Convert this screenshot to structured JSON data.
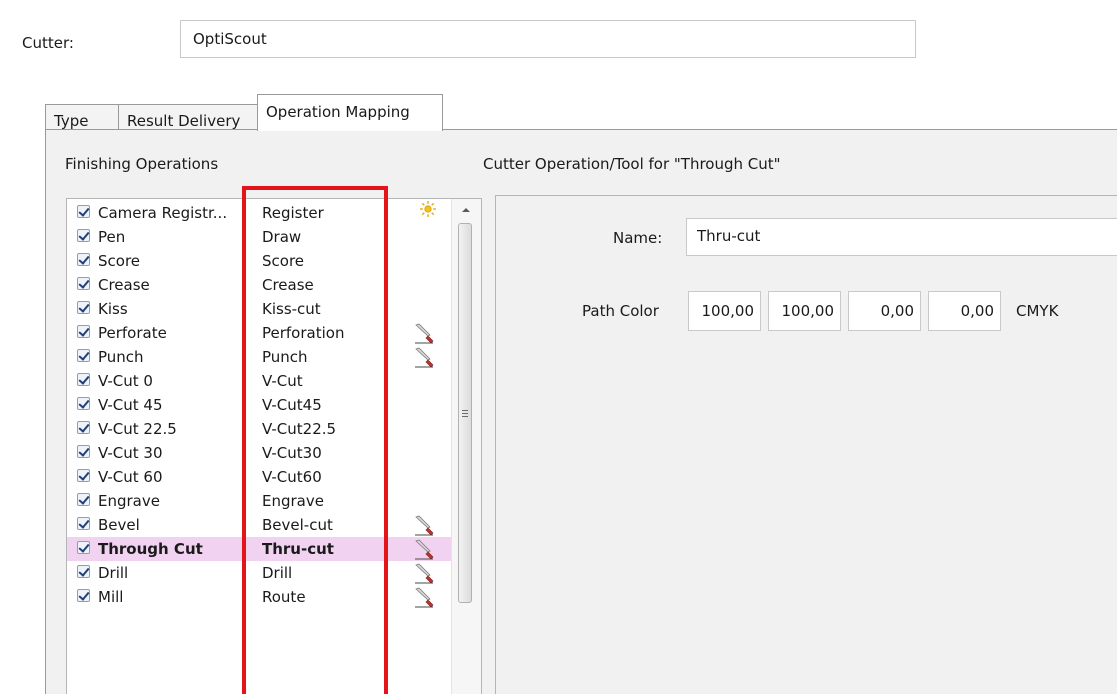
{
  "cutter": {
    "label": "Cutter:",
    "value": "OptiScout"
  },
  "tabs": [
    {
      "label": "Type",
      "active": false
    },
    {
      "label": "Result Delivery",
      "active": false
    },
    {
      "label": "Operation Mapping",
      "active": true
    }
  ],
  "left": {
    "title": "Finishing Operations",
    "rows": [
      {
        "operation": "Camera Registr...",
        "tool": "Register",
        "checked": true,
        "icon": "sun-icon"
      },
      {
        "operation": "Pen",
        "tool": "Draw",
        "checked": true,
        "icon": ""
      },
      {
        "operation": "Score",
        "tool": "Score",
        "checked": true,
        "icon": ""
      },
      {
        "operation": "Crease",
        "tool": "Crease",
        "checked": true,
        "icon": ""
      },
      {
        "operation": "Kiss",
        "tool": "Kiss-cut",
        "checked": true,
        "icon": ""
      },
      {
        "operation": "Perforate",
        "tool": "Perforation",
        "checked": true,
        "icon": "knife-icon"
      },
      {
        "operation": "Punch",
        "tool": "Punch",
        "checked": true,
        "icon": "knife-icon"
      },
      {
        "operation": "V-Cut 0",
        "tool": "V-Cut",
        "checked": true,
        "icon": ""
      },
      {
        "operation": "V-Cut 45",
        "tool": "V-Cut45",
        "checked": true,
        "icon": ""
      },
      {
        "operation": "V-Cut 22.5",
        "tool": "V-Cut22.5",
        "checked": true,
        "icon": ""
      },
      {
        "operation": "V-Cut 30",
        "tool": "V-Cut30",
        "checked": true,
        "icon": ""
      },
      {
        "operation": "V-Cut 60",
        "tool": "V-Cut60",
        "checked": true,
        "icon": ""
      },
      {
        "operation": "Engrave",
        "tool": "Engrave",
        "checked": true,
        "icon": ""
      },
      {
        "operation": "Bevel",
        "tool": "Bevel-cut",
        "checked": true,
        "icon": "knife-icon"
      },
      {
        "operation": "Through Cut",
        "tool": "Thru-cut",
        "checked": true,
        "icon": "knife-icon",
        "selected": true
      },
      {
        "operation": "Drill",
        "tool": "Drill",
        "checked": true,
        "icon": "knife-icon"
      },
      {
        "operation": "Mill",
        "tool": "Route",
        "checked": true,
        "icon": "knife-icon"
      }
    ]
  },
  "right": {
    "title": "Cutter Operation/Tool for \"Through Cut\"",
    "name_label": "Name:",
    "name_value": "Thru-cut",
    "path_color_label": "Path Color",
    "path_color_values": [
      "100,00",
      "100,00",
      "0,00",
      "0,00"
    ],
    "color_model": "CMYK"
  },
  "colors": {
    "highlight_border": "#e3151b",
    "selected_row": "#f1d2f1"
  }
}
